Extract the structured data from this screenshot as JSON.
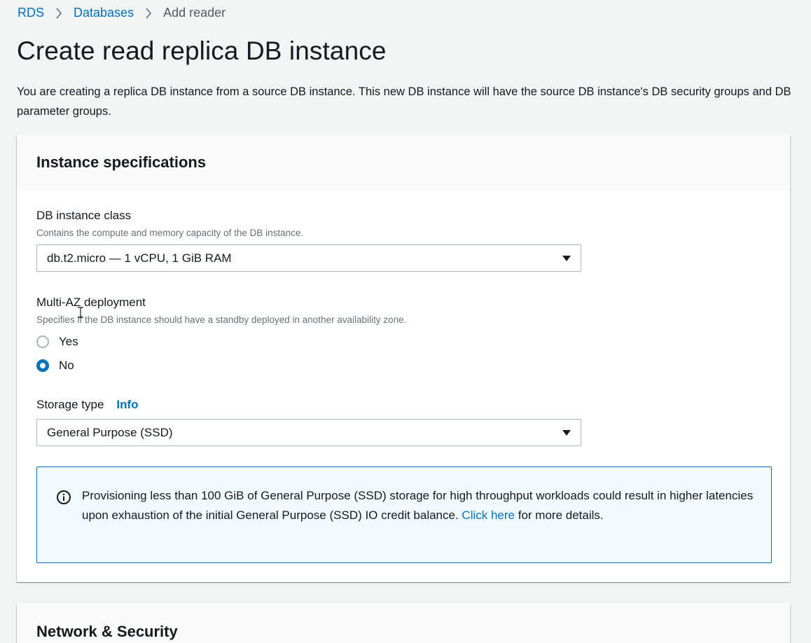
{
  "breadcrumb": {
    "items": [
      "RDS",
      "Databases"
    ],
    "current": "Add reader"
  },
  "page": {
    "title": "Create read replica DB instance",
    "description": "You are creating a replica DB instance from a source DB instance. This new DB instance will have the source DB instance's DB security groups and DB parameter groups."
  },
  "instance_specs": {
    "title": "Instance specifications",
    "db_class": {
      "label": "DB instance class",
      "description": "Contains the compute and memory capacity of the DB instance.",
      "value": "db.t2.micro — 1 vCPU, 1 GiB RAM"
    },
    "multi_az": {
      "label": "Multi-AZ deployment",
      "description": "Specifies if the DB instance should have a standby deployed in another availability zone.",
      "options": [
        "Yes",
        "No"
      ],
      "selected": "No"
    },
    "storage": {
      "label": "Storage type",
      "info": "Info",
      "value": "General Purpose (SSD)"
    },
    "alert": {
      "text_before": "Provisioning less than 100 GiB of General Purpose (SSD) storage for high throughput workloads could result in higher latencies upon exhaustion of the initial General Purpose (SSD) IO credit balance. ",
      "link": "Click here",
      "text_after": " for more details."
    }
  },
  "network": {
    "title": "Network & Security"
  },
  "colors": {
    "link": "#0073bb",
    "background": "#f2f3f3",
    "alert_bg": "#f1faff",
    "alert_border": "#0073bb"
  },
  "icons": {
    "breadcrumb_separator": "chevron-right-icon",
    "select_caret": "caret-down-icon",
    "alert": "info-circle-icon"
  }
}
